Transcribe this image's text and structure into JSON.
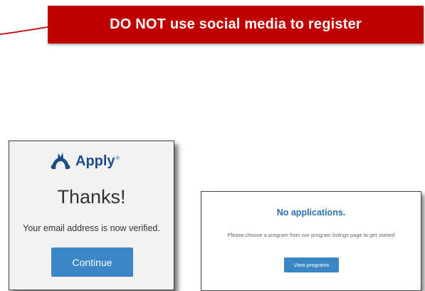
{
  "banner": {
    "text": "DO NOT use social media to register",
    "color": "#c00000"
  },
  "verify_panel": {
    "logo_icon": "mascot-logo-icon",
    "logo_text": "Apply",
    "logo_tm": "®",
    "heading": "Thanks!",
    "message": "Your email address is now verified.",
    "continue_label": "Continue"
  },
  "applications_panel": {
    "heading": "No applications.",
    "message": "Please choose a program from our program listings page to get started",
    "button_label": "View programs"
  },
  "colors": {
    "accent_blue": "#3b86c6",
    "logo_blue": "#1c4c8c",
    "heading_blue": "#2a6fb0"
  }
}
